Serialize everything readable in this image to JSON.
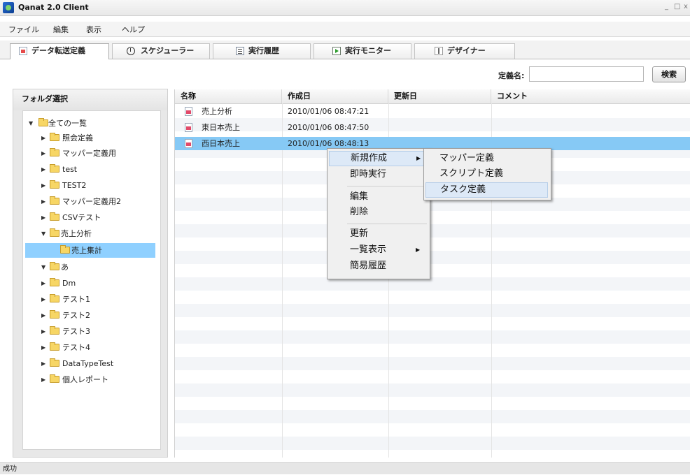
{
  "window": {
    "title": "Qanat 2.0 Client",
    "minimize": "_",
    "maximize": "□",
    "close": "x"
  },
  "menubar": [
    "ファイル",
    "編集",
    "表示",
    "ヘルプ"
  ],
  "tabs": [
    {
      "label": "データ転送定義",
      "icon": "document-icon"
    },
    {
      "label": "スケジューラー",
      "icon": "clock-icon"
    },
    {
      "label": "実行履歴",
      "icon": "history-icon"
    },
    {
      "label": "実行モニター",
      "icon": "play-icon"
    },
    {
      "label": "デザイナー",
      "icon": "designer-icon"
    }
  ],
  "search": {
    "label": "定義名:",
    "value": "",
    "button": "検索"
  },
  "folder_panel": {
    "title": "フォルダ選択",
    "tree": [
      {
        "label": "全ての一覧",
        "expanded": true
      },
      {
        "label": "照会定義"
      },
      {
        "label": "マッパー定義用"
      },
      {
        "label": "test"
      },
      {
        "label": "TEST2"
      },
      {
        "label": "マッパー定義用2"
      },
      {
        "label": "CSVテスト"
      },
      {
        "label": "売上分析",
        "expanded": true
      },
      {
        "label": "売上集計",
        "selected": true
      },
      {
        "label": "あ",
        "expanded": true
      },
      {
        "label": "Dm"
      },
      {
        "label": "テスト1"
      },
      {
        "label": "テスト2"
      },
      {
        "label": "テスト3"
      },
      {
        "label": "テスト4"
      },
      {
        "label": "DataTypeTest"
      },
      {
        "label": "個人レポート"
      }
    ]
  },
  "grid": {
    "columns": [
      "名称",
      "作成日",
      "更新日",
      "コメント"
    ],
    "rows": [
      {
        "name": "売上分析",
        "created": "2010/01/06 08:47:21",
        "updated": "",
        "comment": ""
      },
      {
        "name": "東日本売上",
        "created": "2010/01/06 08:47:50",
        "updated": "",
        "comment": ""
      },
      {
        "name": "西日本売上",
        "created": "2010/01/06 08:48:13",
        "updated": "",
        "comment": "",
        "selected": true
      }
    ]
  },
  "context_menu": {
    "items": [
      {
        "label": "新規作成",
        "submenu": true,
        "highlighted": true
      },
      {
        "label": "即時実行"
      },
      {
        "label": "編集"
      },
      {
        "label": "削除"
      },
      {
        "label": "更新"
      },
      {
        "label": "一覧表示",
        "submenu": true
      },
      {
        "label": "簡易履歴"
      }
    ],
    "submenu": [
      {
        "label": "マッパー定義"
      },
      {
        "label": "スクリプト定義"
      },
      {
        "label": "タスク定義",
        "highlighted": true
      }
    ]
  },
  "status": "成功",
  "colors": {
    "selection": "#86c9f5",
    "tree_selection": "#8fd0ff",
    "menu_highlight": "#dde9f7"
  }
}
